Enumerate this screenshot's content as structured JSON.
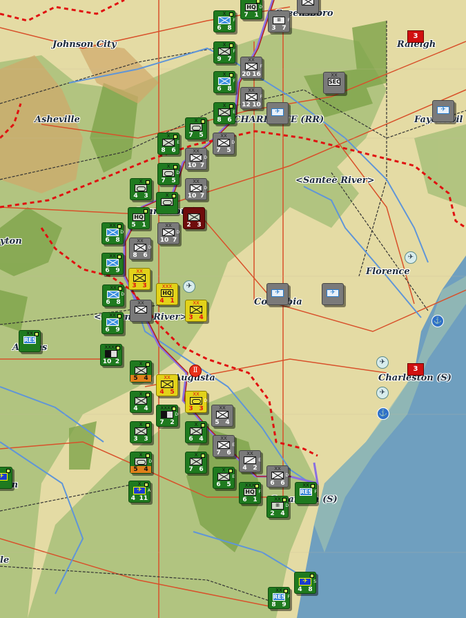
{
  "cities": [
    "Greensboro",
    "Johnson City",
    "Raleigh",
    "Asheville",
    "CHARLOTTE (RR)",
    "Fayettevil",
    "<Santee River>",
    "Spartanburg",
    "yton",
    "Florence",
    "Columbia",
    "<Savannah River>",
    "Athens",
    "Augusta",
    "Charleston (S)",
    "con",
    "Savannah (S)",
    "le"
  ],
  "victory_points": [
    {
      "city": "Raleigh",
      "value": "3"
    },
    {
      "city": "Charleston",
      "value": "3"
    }
  ],
  "colors": {
    "allied": "#1f7a1f",
    "axis": "#7a7a7a",
    "italian": "#e2d21a",
    "ocean": "#6f9fbf",
    "border": "#e01010"
  },
  "units": [
    {
      "side": "allied",
      "size": "",
      "type": "HQ",
      "a": "7",
      "b": "1",
      "flag": "D"
    },
    {
      "side": "allied",
      "size": "X",
      "type": "blue",
      "a": "6",
      "b": "8",
      "flag": "F"
    },
    {
      "side": "allied",
      "size": "X",
      "type": "inf",
      "a": "9",
      "b": "7",
      "flag": "F"
    },
    {
      "side": "allied",
      "size": "X",
      "type": "blue",
      "a": "6",
      "b": "8",
      "flag": "F"
    },
    {
      "side": "allied",
      "size": "X",
      "type": "inf",
      "a": "8",
      "b": "6",
      "flag": "E"
    },
    {
      "side": "allied",
      "size": "X",
      "type": "arm",
      "a": "7",
      "b": "5",
      "flag": ""
    },
    {
      "side": "allied",
      "size": "X",
      "type": "inf",
      "a": "8",
      "b": "6",
      "flag": "E"
    },
    {
      "side": "allied",
      "size": "X",
      "type": "arm",
      "a": "7",
      "b": "5",
      "flag": "D"
    },
    {
      "side": "allied",
      "size": "X",
      "type": "arm",
      "a": "4",
      "b": "3",
      "flag": ""
    },
    {
      "side": "allied",
      "size": "X",
      "type": "arm",
      "a": "",
      "b": "",
      "flag": ""
    },
    {
      "side": "allied",
      "size": "",
      "type": "HQ",
      "a": "5",
      "b": "1",
      "flag": ""
    },
    {
      "side": "allied",
      "size": "XX",
      "type": "blue",
      "a": "6",
      "b": "8",
      "flag": "D"
    },
    {
      "side": "allied",
      "size": "XX",
      "type": "blue",
      "a": "6",
      "b": "9",
      "flag": ""
    },
    {
      "side": "allied",
      "size": "XX",
      "type": "blue",
      "a": "6",
      "b": "8",
      "flag": "D"
    },
    {
      "side": "allied",
      "size": "XX",
      "type": "blue",
      "a": "6",
      "b": "9",
      "flag": ""
    },
    {
      "side": "allied",
      "size": "XX",
      "type": "res",
      "a": "",
      "b": "",
      "flag": ""
    },
    {
      "side": "allied",
      "size": "XXXX",
      "type": "army",
      "a": "10",
      "b": "2",
      "flag": ""
    },
    {
      "side": "allied",
      "size": "X",
      "type": "inf",
      "a": "5",
      "b": "4",
      "flag": "",
      "orange": true
    },
    {
      "side": "allied",
      "size": "X",
      "type": "inf",
      "a": "4",
      "b": "4",
      "flag": ""
    },
    {
      "side": "allied",
      "size": "XXXX",
      "type": "army",
      "a": "7",
      "b": "2",
      "flag": "D"
    },
    {
      "side": "allied",
      "size": "X",
      "type": "inf",
      "a": "3",
      "b": "3",
      "flag": ""
    },
    {
      "side": "allied",
      "size": "X",
      "type": "inf",
      "a": "6",
      "b": "4",
      "flag": ""
    },
    {
      "side": "allied",
      "size": "X",
      "type": "arm",
      "a": "5",
      "b": "4",
      "flag": "D",
      "orange": true
    },
    {
      "side": "allied",
      "size": "X",
      "type": "inf",
      "a": "7",
      "b": "6",
      "flag": ""
    },
    {
      "side": "allied",
      "size": "X",
      "type": "air",
      "a": "4",
      "b": "11",
      "flag": "A"
    },
    {
      "side": "allied",
      "size": "X",
      "type": "inf",
      "a": "6",
      "b": "5",
      "flag": "E"
    },
    {
      "side": "allied",
      "size": "XXX",
      "type": "HQ",
      "a": "6",
      "b": "1",
      "flag": "F"
    },
    {
      "side": "allied",
      "size": "XX",
      "type": "mtn",
      "a": "2",
      "b": "4",
      "flag": "D"
    },
    {
      "side": "allied",
      "size": "XX",
      "type": "res",
      "a": "",
      "b": "",
      "flag": "F"
    },
    {
      "side": "allied",
      "size": "XX",
      "type": "res",
      "a": "8",
      "b": "9",
      "flag": "F"
    },
    {
      "side": "allied",
      "size": "",
      "type": "air",
      "a": "4",
      "b": "8",
      "flag": "S"
    },
    {
      "side": "allied",
      "size": "",
      "type": "air",
      "a": "",
      "b": "",
      "flag": ""
    },
    {
      "side": "axis",
      "size": "XX",
      "type": "inf",
      "a": "",
      "b": "",
      "flag": ""
    },
    {
      "side": "axis",
      "size": "",
      "type": "mtn",
      "a": "3",
      "b": "7",
      "flag": "F"
    },
    {
      "side": "axis",
      "size": "XX",
      "type": "inf",
      "a": "20",
      "b": "16",
      "flag": "F"
    },
    {
      "side": "axis",
      "size": "XX",
      "type": "inf",
      "a": "12",
      "b": "10",
      "flag": "F"
    },
    {
      "side": "axis",
      "size": "",
      "type": "airg",
      "a": "",
      "b": "",
      "flag": ""
    },
    {
      "side": "axis",
      "size": "XX",
      "type": "inf",
      "a": "7",
      "b": "5",
      "flag": "D"
    },
    {
      "side": "axis",
      "size": "XX",
      "type": "inf",
      "a": "10",
      "b": "7",
      "flag": "D"
    },
    {
      "side": "axis",
      "size": "XX",
      "type": "inf",
      "a": "10",
      "b": "7",
      "flag": "D"
    },
    {
      "side": "axis",
      "size": "XX",
      "type": "inf",
      "a": "10",
      "b": "7",
      "flag": "D"
    },
    {
      "side": "axis",
      "size": "XX",
      "type": "inf",
      "a": "8",
      "b": "6",
      "flag": "D"
    },
    {
      "side": "axis",
      "size": "XX",
      "type": "inf",
      "a": "",
      "b": "",
      "flag": ""
    },
    {
      "side": "axis",
      "size": "XX",
      "type": "SEC",
      "a": "",
      "b": "",
      "flag": ""
    },
    {
      "side": "axis",
      "size": "",
      "type": "airg",
      "a": "",
      "b": "",
      "flag": ""
    },
    {
      "side": "axis",
      "size": "",
      "type": "airg",
      "a": "",
      "b": "",
      "flag": ""
    },
    {
      "side": "axis",
      "size": "",
      "type": "airg",
      "a": "",
      "b": "",
      "flag": ""
    },
    {
      "side": "axis",
      "size": "XX",
      "type": "inf",
      "a": "5",
      "b": "4",
      "flag": ""
    },
    {
      "side": "axis",
      "size": "XX",
      "type": "inf",
      "a": "7",
      "b": "6",
      "flag": "E"
    },
    {
      "side": "axis",
      "size": "XX",
      "type": "cav",
      "a": "4",
      "b": "2",
      "flag": "E"
    },
    {
      "side": "axis",
      "size": "XX",
      "type": "inf",
      "a": "6",
      "b": "6",
      "flag": "D"
    },
    {
      "side": "italian",
      "size": "XX",
      "type": "inf",
      "a": "3",
      "b": "3",
      "flag": ""
    },
    {
      "side": "italian",
      "size": "XXX",
      "type": "HQ",
      "a": "4",
      "b": "1",
      "flag": ""
    },
    {
      "side": "italian",
      "size": "XX",
      "type": "inf",
      "a": "3",
      "b": "4",
      "flag": ""
    },
    {
      "side": "italian",
      "size": "XX",
      "type": "inf",
      "a": "4",
      "b": "5",
      "flag": ""
    },
    {
      "side": "italian",
      "size": "XX",
      "type": "arm",
      "a": "3",
      "b": "3",
      "flag": "D"
    },
    {
      "side": "red",
      "size": "",
      "type": "inf",
      "a": "2",
      "b": "3",
      "flag": ""
    }
  ]
}
